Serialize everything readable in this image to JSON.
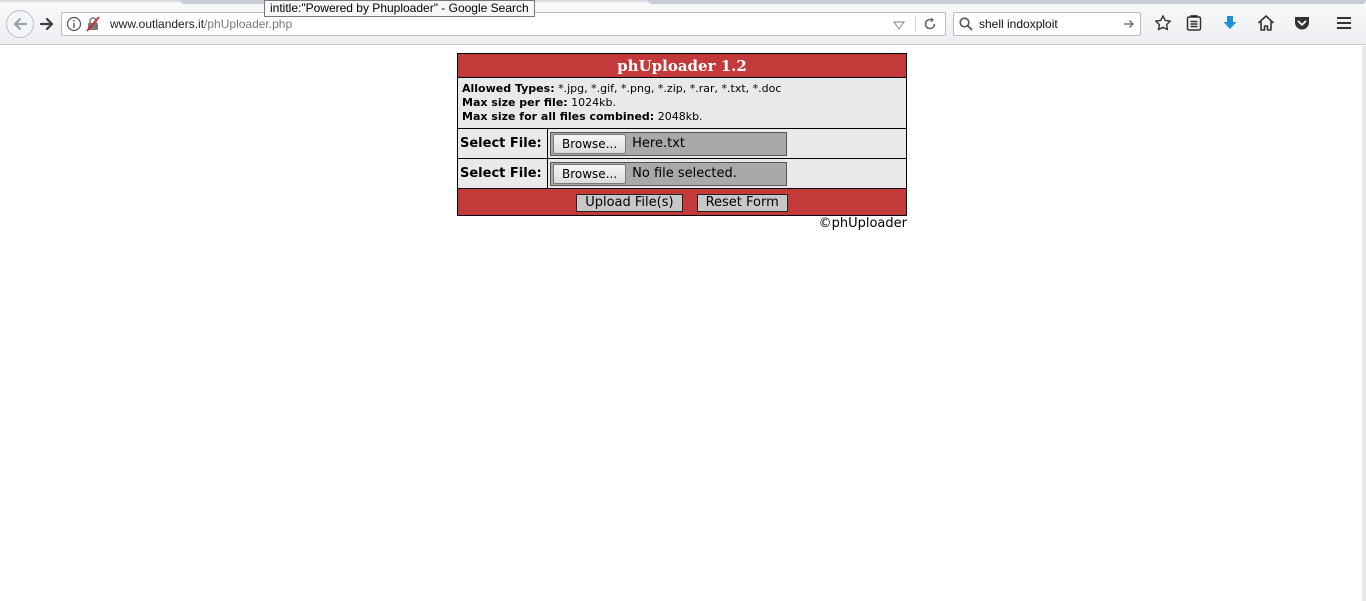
{
  "browser": {
    "tooltip": "intitle:\"Powered by Phuploader\" - Google Search",
    "url": {
      "domain": "www.outlanders.it",
      "path": "/phUploader.php"
    },
    "search": {
      "value": "shell indoxploit"
    }
  },
  "uploader": {
    "title": "phUploader 1.2",
    "allowed_types_label": "Allowed Types:",
    "allowed_types_value": " *.jpg, *.gif, *.png, *.zip, *.rar, *.txt, *.doc",
    "max_per_file_label": "Max size per file:",
    "max_per_file_value": " 1024kb.",
    "max_total_label": "Max size for all files combined:",
    "max_total_value": " 2048kb.",
    "file_rows": [
      {
        "label": "Select File:",
        "button": "Browse...",
        "file": "Here.txt"
      },
      {
        "label": "Select File:",
        "button": "Browse...",
        "file": "No file selected."
      }
    ],
    "upload_label": "Upload File(s)",
    "reset_label": "Reset Form",
    "copyright": "©phUploader"
  },
  "colors": {
    "header_red": "#c43a3a",
    "panel_grey": "#e9e9e9"
  }
}
